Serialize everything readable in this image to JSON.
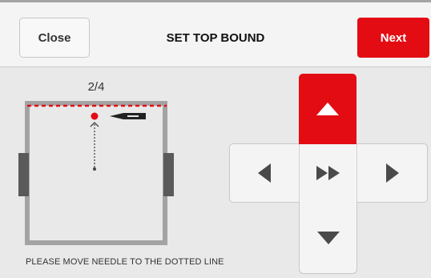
{
  "header": {
    "close_label": "Close",
    "title": "SET TOP BOUND",
    "next_label": "Next"
  },
  "step_indicator": "2/4",
  "instruction": "PLEASE MOVE NEEDLE TO THE DOTTED LINE",
  "colors": {
    "accent": "#e30c13",
    "background": "#e9e9e9",
    "panel": "#f4f4f4",
    "icon": "#4a4a4a"
  },
  "icons": {
    "up": "triangle-up-icon",
    "left": "triangle-left-icon",
    "center": "fast-forward-icon",
    "right": "triangle-right-icon",
    "down": "triangle-down-icon"
  }
}
